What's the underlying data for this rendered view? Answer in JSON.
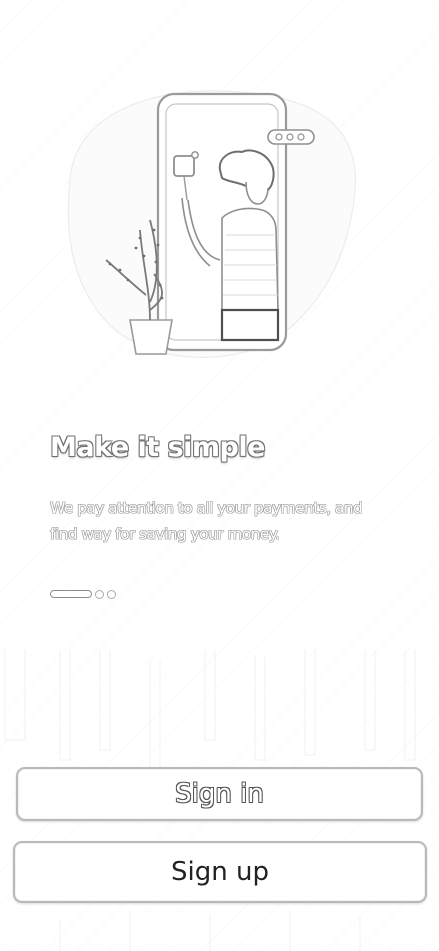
{
  "onboarding": {
    "title": "Make it simple",
    "subtitle": "We pay attention to all your payments, and find way for saving your money.",
    "pager": {
      "total": 3,
      "active_index": 0
    }
  },
  "actions": {
    "sign_in_label": "Sign in",
    "sign_up_label": "Sign up"
  },
  "illustration": {
    "subject": "person-taking-selfie-in-phone-with-plant-icon"
  },
  "colors": {
    "background": "#ffffff",
    "outline": "#8d8d8d",
    "button_border": "#b9b9b9",
    "sign_up_text": "#222222"
  }
}
